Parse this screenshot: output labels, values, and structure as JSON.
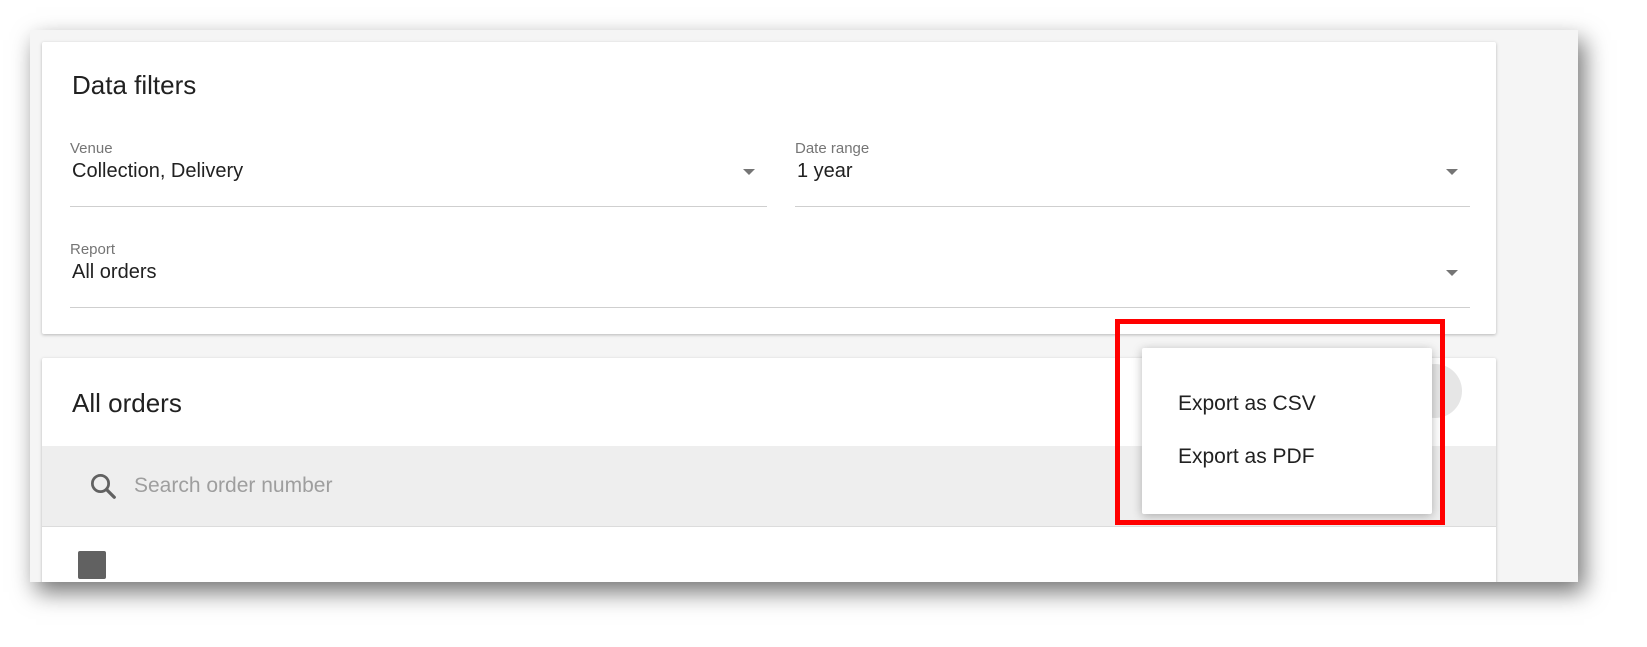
{
  "filters": {
    "title": "Data filters",
    "venue": {
      "label": "Venue",
      "value": "Collection, Delivery"
    },
    "date_range": {
      "label": "Date range",
      "value": "1 year"
    },
    "report": {
      "label": "Report",
      "value": "All orders"
    }
  },
  "orders": {
    "title": "All orders",
    "search": {
      "placeholder": "Search order number",
      "value": ""
    }
  },
  "menu": {
    "items": [
      {
        "label": "Export as CSV"
      },
      {
        "label": "Export as PDF"
      }
    ]
  },
  "colors": {
    "highlight": "#ff0000",
    "search_bar_bg": "#eeeeee",
    "text_primary": "#212121",
    "text_secondary": "#757575"
  }
}
